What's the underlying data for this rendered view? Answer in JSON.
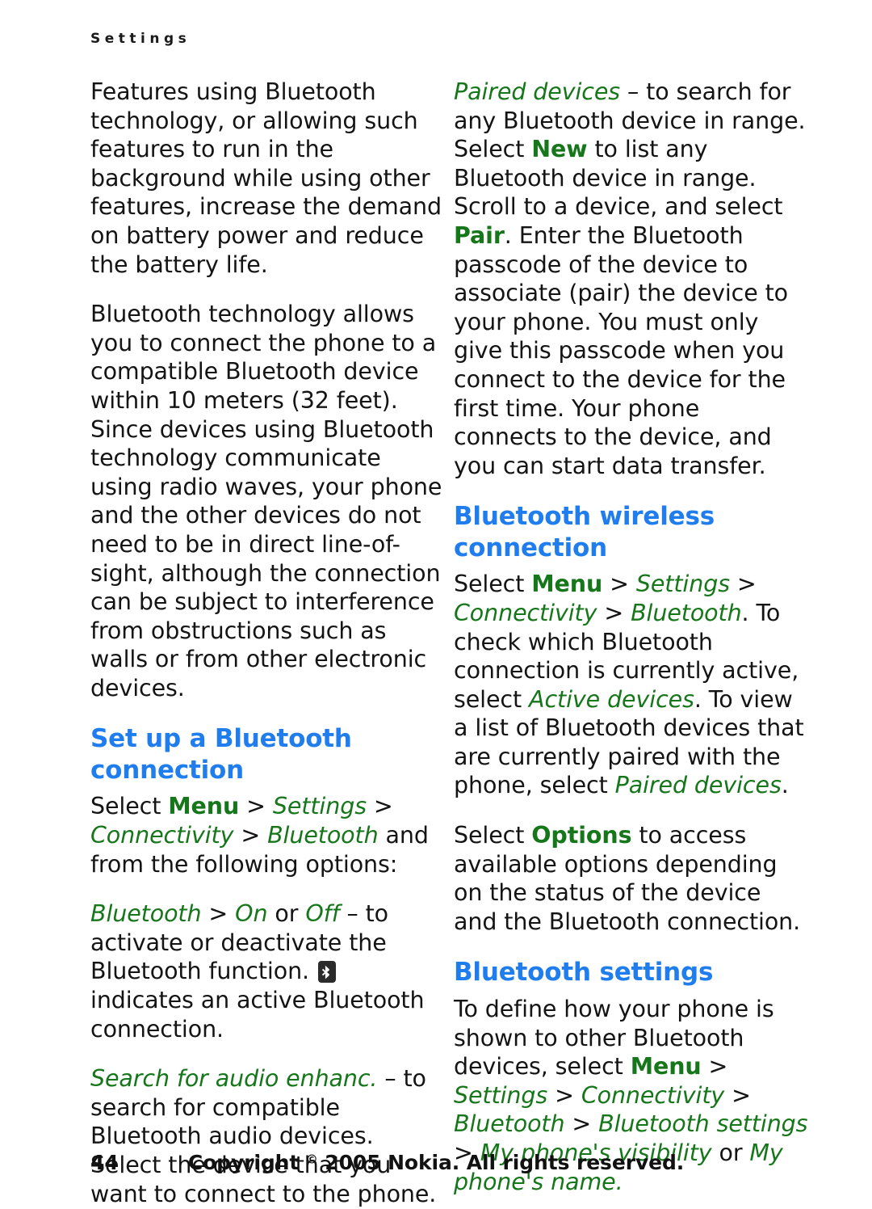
{
  "header": {
    "running_title": "Settings"
  },
  "colors": {
    "heading_blue": "#1f7ded",
    "menu_green": "#16761a",
    "body_black": "#141414"
  },
  "left_column": {
    "para1": "Features using Bluetooth technology, or allowing such features to run in the background while using other features, increase the demand on battery power and reduce the battery life.",
    "para2": "Bluetooth technology allows you to connect the phone to a compatible Bluetooth device within 10 meters (32 feet). Since devices using Bluetooth technology communicate using radio waves, your phone and the other devices do not need to be in direct line-of-sight, although the connection can be subject to interference from obstructions such as walls or from other electronic devices.",
    "heading_setup": "Set up a Bluetooth connection",
    "setup_path": {
      "select": "Select ",
      "menu": "Menu",
      "sep1": " > ",
      "settings": "Settings",
      "sep2": " > ",
      "connectivity": "Connectivity",
      "sep3": " > ",
      "bluetooth": "Bluetooth",
      "tail": " and from the following options:"
    },
    "option_bluetooth": {
      "term": "Bluetooth",
      "sep": " > ",
      "on": "On",
      "or": " or ",
      "off": "Off",
      "text_before_icon": " – to activate or deactivate the Bluetooth function. ",
      "icon": "bluetooth-icon",
      "text_after_icon": " indicates an active Bluetooth connection."
    },
    "option_search_audio": {
      "term": "Search for audio enhanc.",
      "text": " – to search for compatible Bluetooth audio devices. Select the device that you want to connect to the phone."
    }
  },
  "right_column": {
    "option_paired": {
      "term": "Paired devices",
      "text1": " – to search for any Bluetooth device in range. Select ",
      "new": "New",
      "text2": " to list any Bluetooth device in range. Scroll to a device, and select ",
      "pair": "Pair",
      "text3": ". Enter the Bluetooth passcode of the device to associate (pair) the device to your phone. You must only give this passcode when you connect to the device for the first time. Your phone connects to the device, and you can start data transfer."
    },
    "heading_wireless": "Bluetooth wireless connection",
    "wireless_para": {
      "select": "Select ",
      "menu": "Menu",
      "sep1": " > ",
      "settings": "Settings",
      "sep2": " > ",
      "connectivity": "Connectivity",
      "sep3": " > ",
      "bluetooth": "Bluetooth",
      "text1": ". To check which Bluetooth connection is currently active, select ",
      "active_devices": "Active devices",
      "text2": ". To view a list of Bluetooth devices that are currently paired with the phone, select ",
      "paired_devices": "Paired devices",
      "text3": "."
    },
    "options_para": {
      "select": "Select ",
      "options": "Options",
      "text": " to access available options depending on the status of the device and the Bluetooth connection."
    },
    "heading_settings": "Bluetooth settings",
    "settings_para": {
      "text1": "To define how your phone is shown to other Bluetooth devices, select ",
      "menu": "Menu",
      "sep1": " > ",
      "settings": "Settings",
      "sep2": " > ",
      "connectivity": "Connectivity",
      "sep3": " > ",
      "bluetooth": "Bluetooth",
      "sep4": " > ",
      "bluetooth_settings": "Bluetooth settings",
      "sep5": " > ",
      "visibility": "My phone's visibility",
      "or": " or ",
      "phone_name": "My phone's name",
      "period": "."
    }
  },
  "footer": {
    "page_number": "44",
    "copyright_prefix": "Copyright ",
    "copyright_symbol": "©",
    "copyright_suffix": " 2005 Nokia. All rights reserved."
  }
}
